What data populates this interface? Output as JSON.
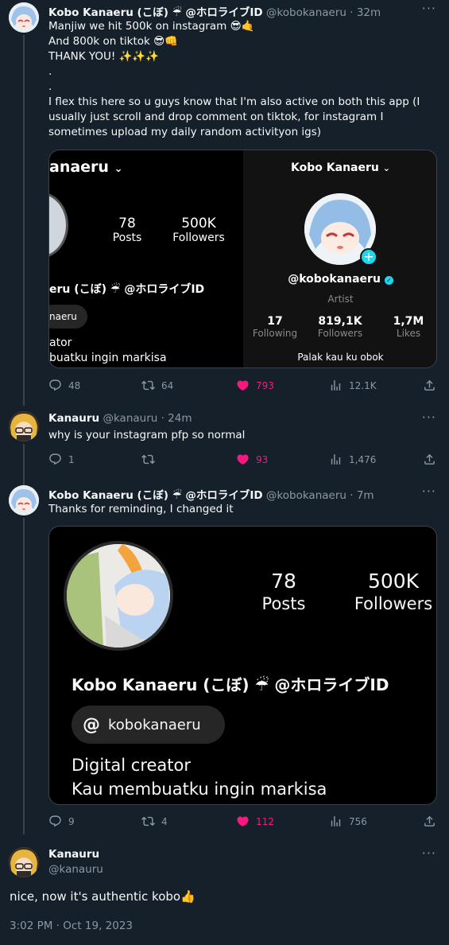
{
  "tweets": [
    {
      "name": "Kobo Kanaeru (こぼ) ☔ @ホロライブID",
      "handle": "@kobokanaeru · 32m",
      "lines": [
        "Manjiw we hit 500k on instagram 😎🤙",
        "And 800k on tiktok 😎👊",
        "THANK YOU! ✨✨✨",
        ".",
        ".",
        "I flex this here so u guys know that I'm also active on both this app (I usually just scroll and drop comment on tiktok, for instagram I sometimes upload my daily random activityon igs)"
      ],
      "stats": {
        "replies": "48",
        "retweets": "64",
        "likes": "793",
        "views": "12.1K"
      }
    },
    {
      "name": "Kanauru",
      "handle": "@kanauru · 24m",
      "lines": [
        "why is your instagram pfp so normal"
      ],
      "stats": {
        "replies": "1",
        "retweets": "",
        "likes": "93",
        "views": "1,476"
      }
    },
    {
      "name": "Kobo Kanaeru (こぼ) ☔ @ホロライブID",
      "handle": "@kobokanaeru · 7m",
      "lines": [
        "Thanks for reminding, I changed it"
      ],
      "stats": {
        "replies": "9",
        "retweets": "4",
        "likes": "112",
        "views": "756"
      }
    },
    {
      "name": "Kanauru",
      "handle": "@kanauru",
      "lines": [
        "nice, now it's authentic kobo👍"
      ],
      "timestamp": "3:02 PM · Oct 19, 2023"
    }
  ],
  "media1": {
    "ig": {
      "username": "anaeru",
      "posts_count": "78",
      "posts_label": "Posts",
      "followers_count": "500K",
      "followers_label": "Followers",
      "display_name": "eru (こぼ) ☔ @ホロライブID",
      "threads_chip": "naeru",
      "bio1": "ator",
      "bio2": "buatku ingin markisa"
    },
    "tt": {
      "title": "Kobo Kanaeru",
      "handle": "@kobokanaeru",
      "category": "Artist",
      "following": "17",
      "following_label": "Following",
      "followers": "819,1K",
      "followers_label": "Followers",
      "likes": "1,7M",
      "likes_label": "Likes",
      "bio": "Palak kau ku obok"
    }
  },
  "media2": {
    "posts_count": "78",
    "posts_label": "Posts",
    "followers_count": "500K",
    "followers_label": "Followers",
    "display_name": "Kobo Kanaeru (こぼ) ☔ @ホロライブID",
    "threads_handle": "kobokanaeru",
    "bio1": "Digital creator",
    "bio2": "Kau membuatku ingin markisa"
  },
  "colors": {
    "bg": "#15202b",
    "like": "#f91880",
    "muted": "#8b98a5",
    "verified": "#20d5ec"
  },
  "icons": [
    "reply-icon",
    "retweet-icon",
    "like-icon",
    "views-icon",
    "share-icon",
    "more-icon",
    "chevron-down-icon",
    "threads-icon",
    "verified-icon",
    "plus-icon"
  ]
}
